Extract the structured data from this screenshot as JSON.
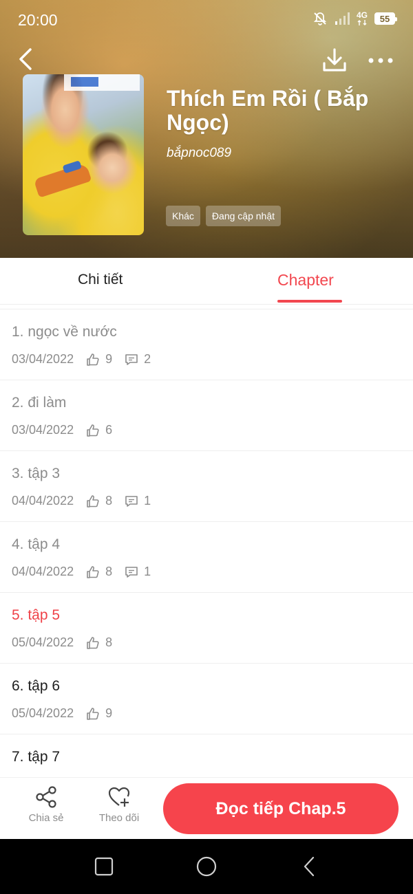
{
  "status_bar": {
    "time": "20:00",
    "network": "4G",
    "battery": "55"
  },
  "header": {
    "title": "Thích Em Rồi ( Bắp Ngọc)",
    "author": "bắpnoc089",
    "tags": [
      "Khác",
      "Đang cập nhật"
    ]
  },
  "tabs": {
    "detail": "Chi tiết",
    "chapter": "Chapter",
    "active": "chapter"
  },
  "chapters": [
    {
      "title": "1. ngọc về nước",
      "date": "03/04/2022",
      "likes": "9",
      "comments": "2",
      "state": "read"
    },
    {
      "title": "2. đi làm",
      "date": "03/04/2022",
      "likes": "6",
      "comments": null,
      "state": "read"
    },
    {
      "title": "3. tập 3",
      "date": "04/04/2022",
      "likes": "8",
      "comments": "1",
      "state": "read"
    },
    {
      "title": "4. tập 4",
      "date": "04/04/2022",
      "likes": "8",
      "comments": "1",
      "state": "read"
    },
    {
      "title": "5. tập 5",
      "date": "05/04/2022",
      "likes": "8",
      "comments": null,
      "state": "current"
    },
    {
      "title": "6. tập 6",
      "date": "05/04/2022",
      "likes": "9",
      "comments": null,
      "state": "unread"
    },
    {
      "title": "7. tập 7",
      "date": null,
      "likes": null,
      "comments": null,
      "state": "unread"
    }
  ],
  "actions": {
    "share": "Chia sẻ",
    "follow": "Theo dõi",
    "read_continue": "Đọc tiếp Chap.5"
  },
  "colors": {
    "accent": "#f2474f",
    "read_text": "#8c8c8c",
    "unread_text": "#1f1f1f"
  },
  "icons": {
    "back": "back-arrow-icon",
    "download": "download-icon",
    "more": "more-dots-icon",
    "like": "thumbs-up-icon",
    "comment": "comment-icon",
    "share": "share-icon",
    "follow": "heart-plus-icon"
  }
}
